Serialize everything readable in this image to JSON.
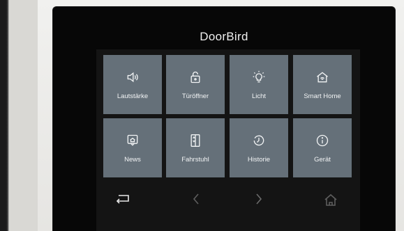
{
  "device": {
    "title": "DoorBird"
  },
  "tiles": [
    {
      "label": "Lautstärke",
      "icon": "speaker-icon"
    },
    {
      "label": "Türöffner",
      "icon": "lock-icon"
    },
    {
      "label": "Licht",
      "icon": "lightbulb-icon"
    },
    {
      "label": "Smart Home",
      "icon": "smart-home-icon"
    },
    {
      "label": "News",
      "icon": "news-icon"
    },
    {
      "label": "Fahrstuhl",
      "icon": "elevator-icon"
    },
    {
      "label": "Historie",
      "icon": "history-clock-icon"
    },
    {
      "label": "Gerät",
      "icon": "info-icon"
    }
  ],
  "navbar": {
    "back_icon": "return-arrow-icon",
    "prev_icon": "chevron-left-icon",
    "next_icon": "chevron-right-icon",
    "home_icon": "home-icon"
  },
  "colors": {
    "tile": "#657079",
    "screen": "#070707",
    "text": "#f2f4f5"
  }
}
